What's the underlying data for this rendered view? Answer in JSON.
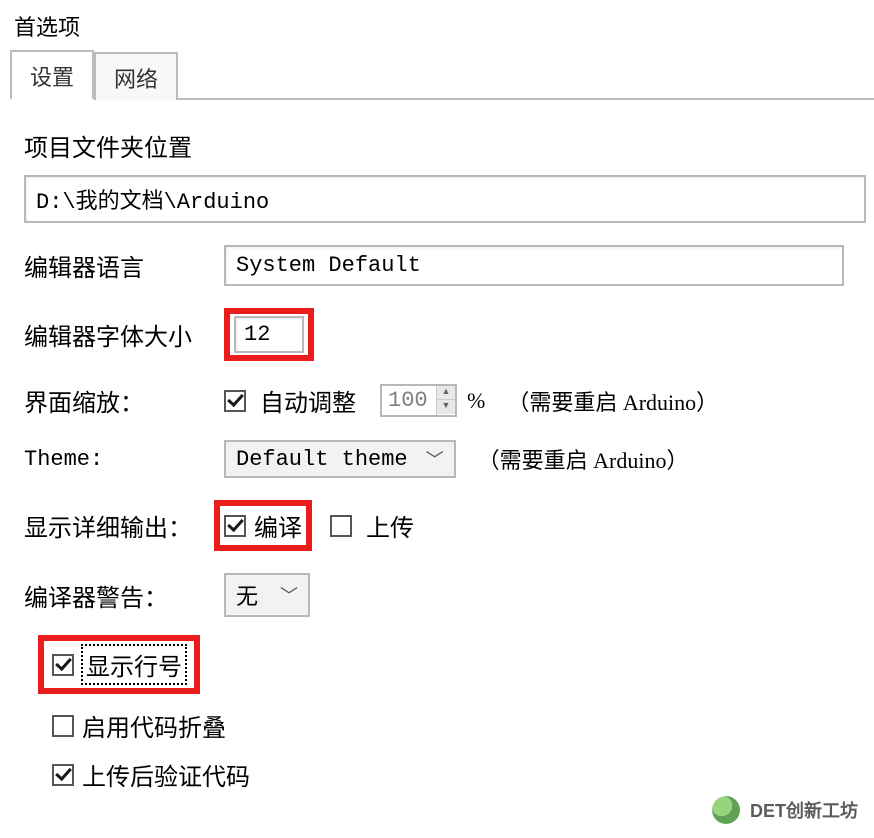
{
  "window": {
    "title": "首选项"
  },
  "tabs": {
    "active": "设置",
    "items": [
      "设置",
      "网络"
    ]
  },
  "sketchbook": {
    "label": "项目文件夹位置",
    "path": "D:\\我的文档\\Arduino"
  },
  "editor_language": {
    "label": "编辑器语言",
    "value": "System Default"
  },
  "editor_font_size": {
    "label": "编辑器字体大小",
    "value": "12"
  },
  "interface_scale": {
    "label": "界面缩放：",
    "auto_label": "自动调整",
    "auto_checked": true,
    "value": "100",
    "suffix": "%",
    "hint": "（需要重启 Arduino）"
  },
  "theme": {
    "label": "Theme:",
    "value": "Default theme",
    "hint": "（需要重启 Arduino）"
  },
  "verbose": {
    "label": "显示详细输出：",
    "compile_label": "编译",
    "compile_checked": true,
    "upload_label": "上传",
    "upload_checked": false
  },
  "compiler_warnings": {
    "label": "编译器警告：",
    "value": "无"
  },
  "options": {
    "line_numbers": {
      "label": "显示行号",
      "checked": true
    },
    "code_folding": {
      "label": "启用代码折叠",
      "checked": false
    },
    "verify_after_upload": {
      "label": "上传后验证代码",
      "checked": true
    }
  },
  "watermark": {
    "text": "DET创新工坊"
  }
}
